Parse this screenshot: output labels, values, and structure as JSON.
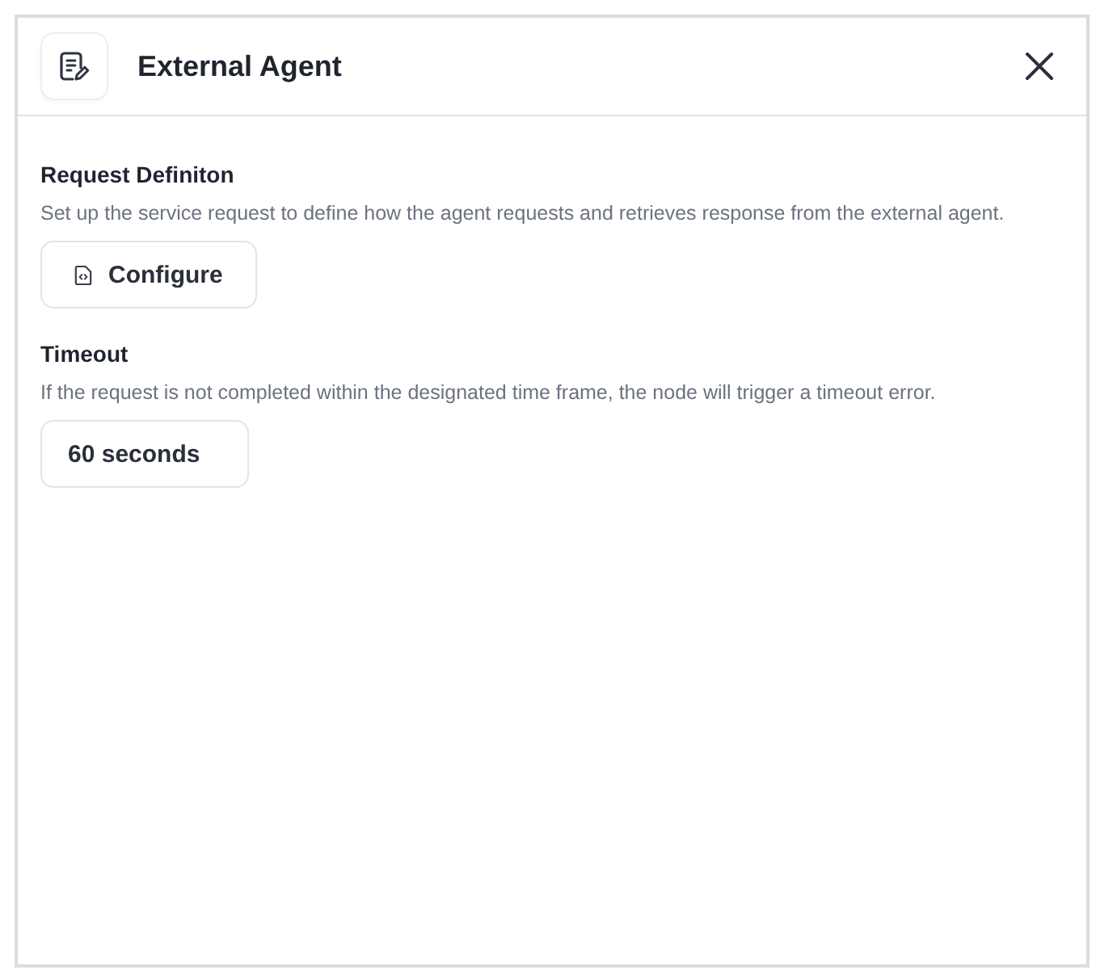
{
  "panel": {
    "title": "External Agent"
  },
  "sections": [
    {
      "kind": "button",
      "title": "Request Definiton",
      "description": "Set up the service request to define how the agent requests and retrieves response from the external agent.",
      "button": "Configure"
    },
    {
      "kind": "field",
      "title": "Timeout",
      "description": "If the request is not completed within the designated time frame, the node will trigger a timeout error.",
      "value": "60 seconds"
    }
  ]
}
